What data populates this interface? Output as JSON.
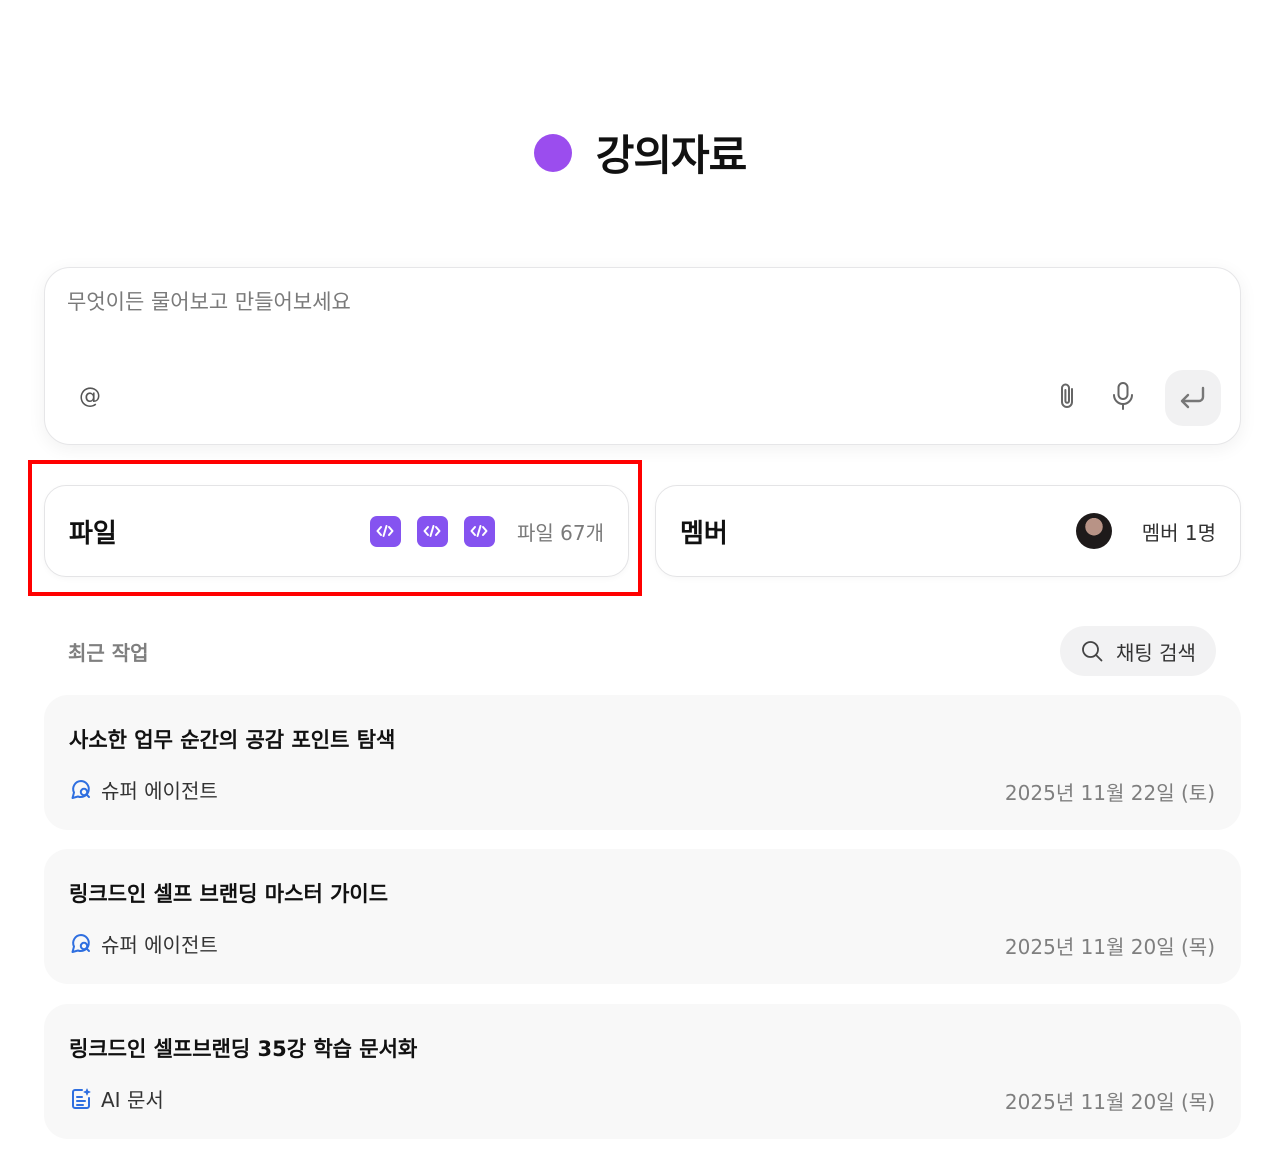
{
  "header": {
    "title": "강의자료",
    "dot_color": "#9b4dee"
  },
  "composer": {
    "placeholder": "무엇이든 물어보고 만들어보세요",
    "mention_symbol": "@"
  },
  "cards": {
    "files": {
      "label": "파일",
      "count_text": "파일 67개",
      "chip_icon": "code-file-icon",
      "chip_color": "#8553f0"
    },
    "members": {
      "label": "멤버",
      "count_text": "멤버 1명"
    }
  },
  "recent": {
    "section_title": "최근 작업",
    "search_label": "채팅 검색",
    "items": [
      {
        "title": "사소한 업무 순간의 공감 포인트 탐색",
        "type": "슈퍼 에이전트",
        "icon": "super-agent-icon",
        "date": "2025년 11월 22일 (토)"
      },
      {
        "title": "링크드인 셀프 브랜딩 마스터 가이드",
        "type": "슈퍼 에이전트",
        "icon": "super-agent-icon",
        "date": "2025년 11월 20일 (목)"
      },
      {
        "title": "링크드인 셀프브랜딩 35강 학습 문서화",
        "type": "AI 문서",
        "icon": "ai-document-icon",
        "date": "2025년 11월 20일 (목)"
      }
    ]
  },
  "colors": {
    "accent_purple": "#8553f0",
    "highlight_red": "#ff0000",
    "icon_blue": "#2f6fe0"
  }
}
